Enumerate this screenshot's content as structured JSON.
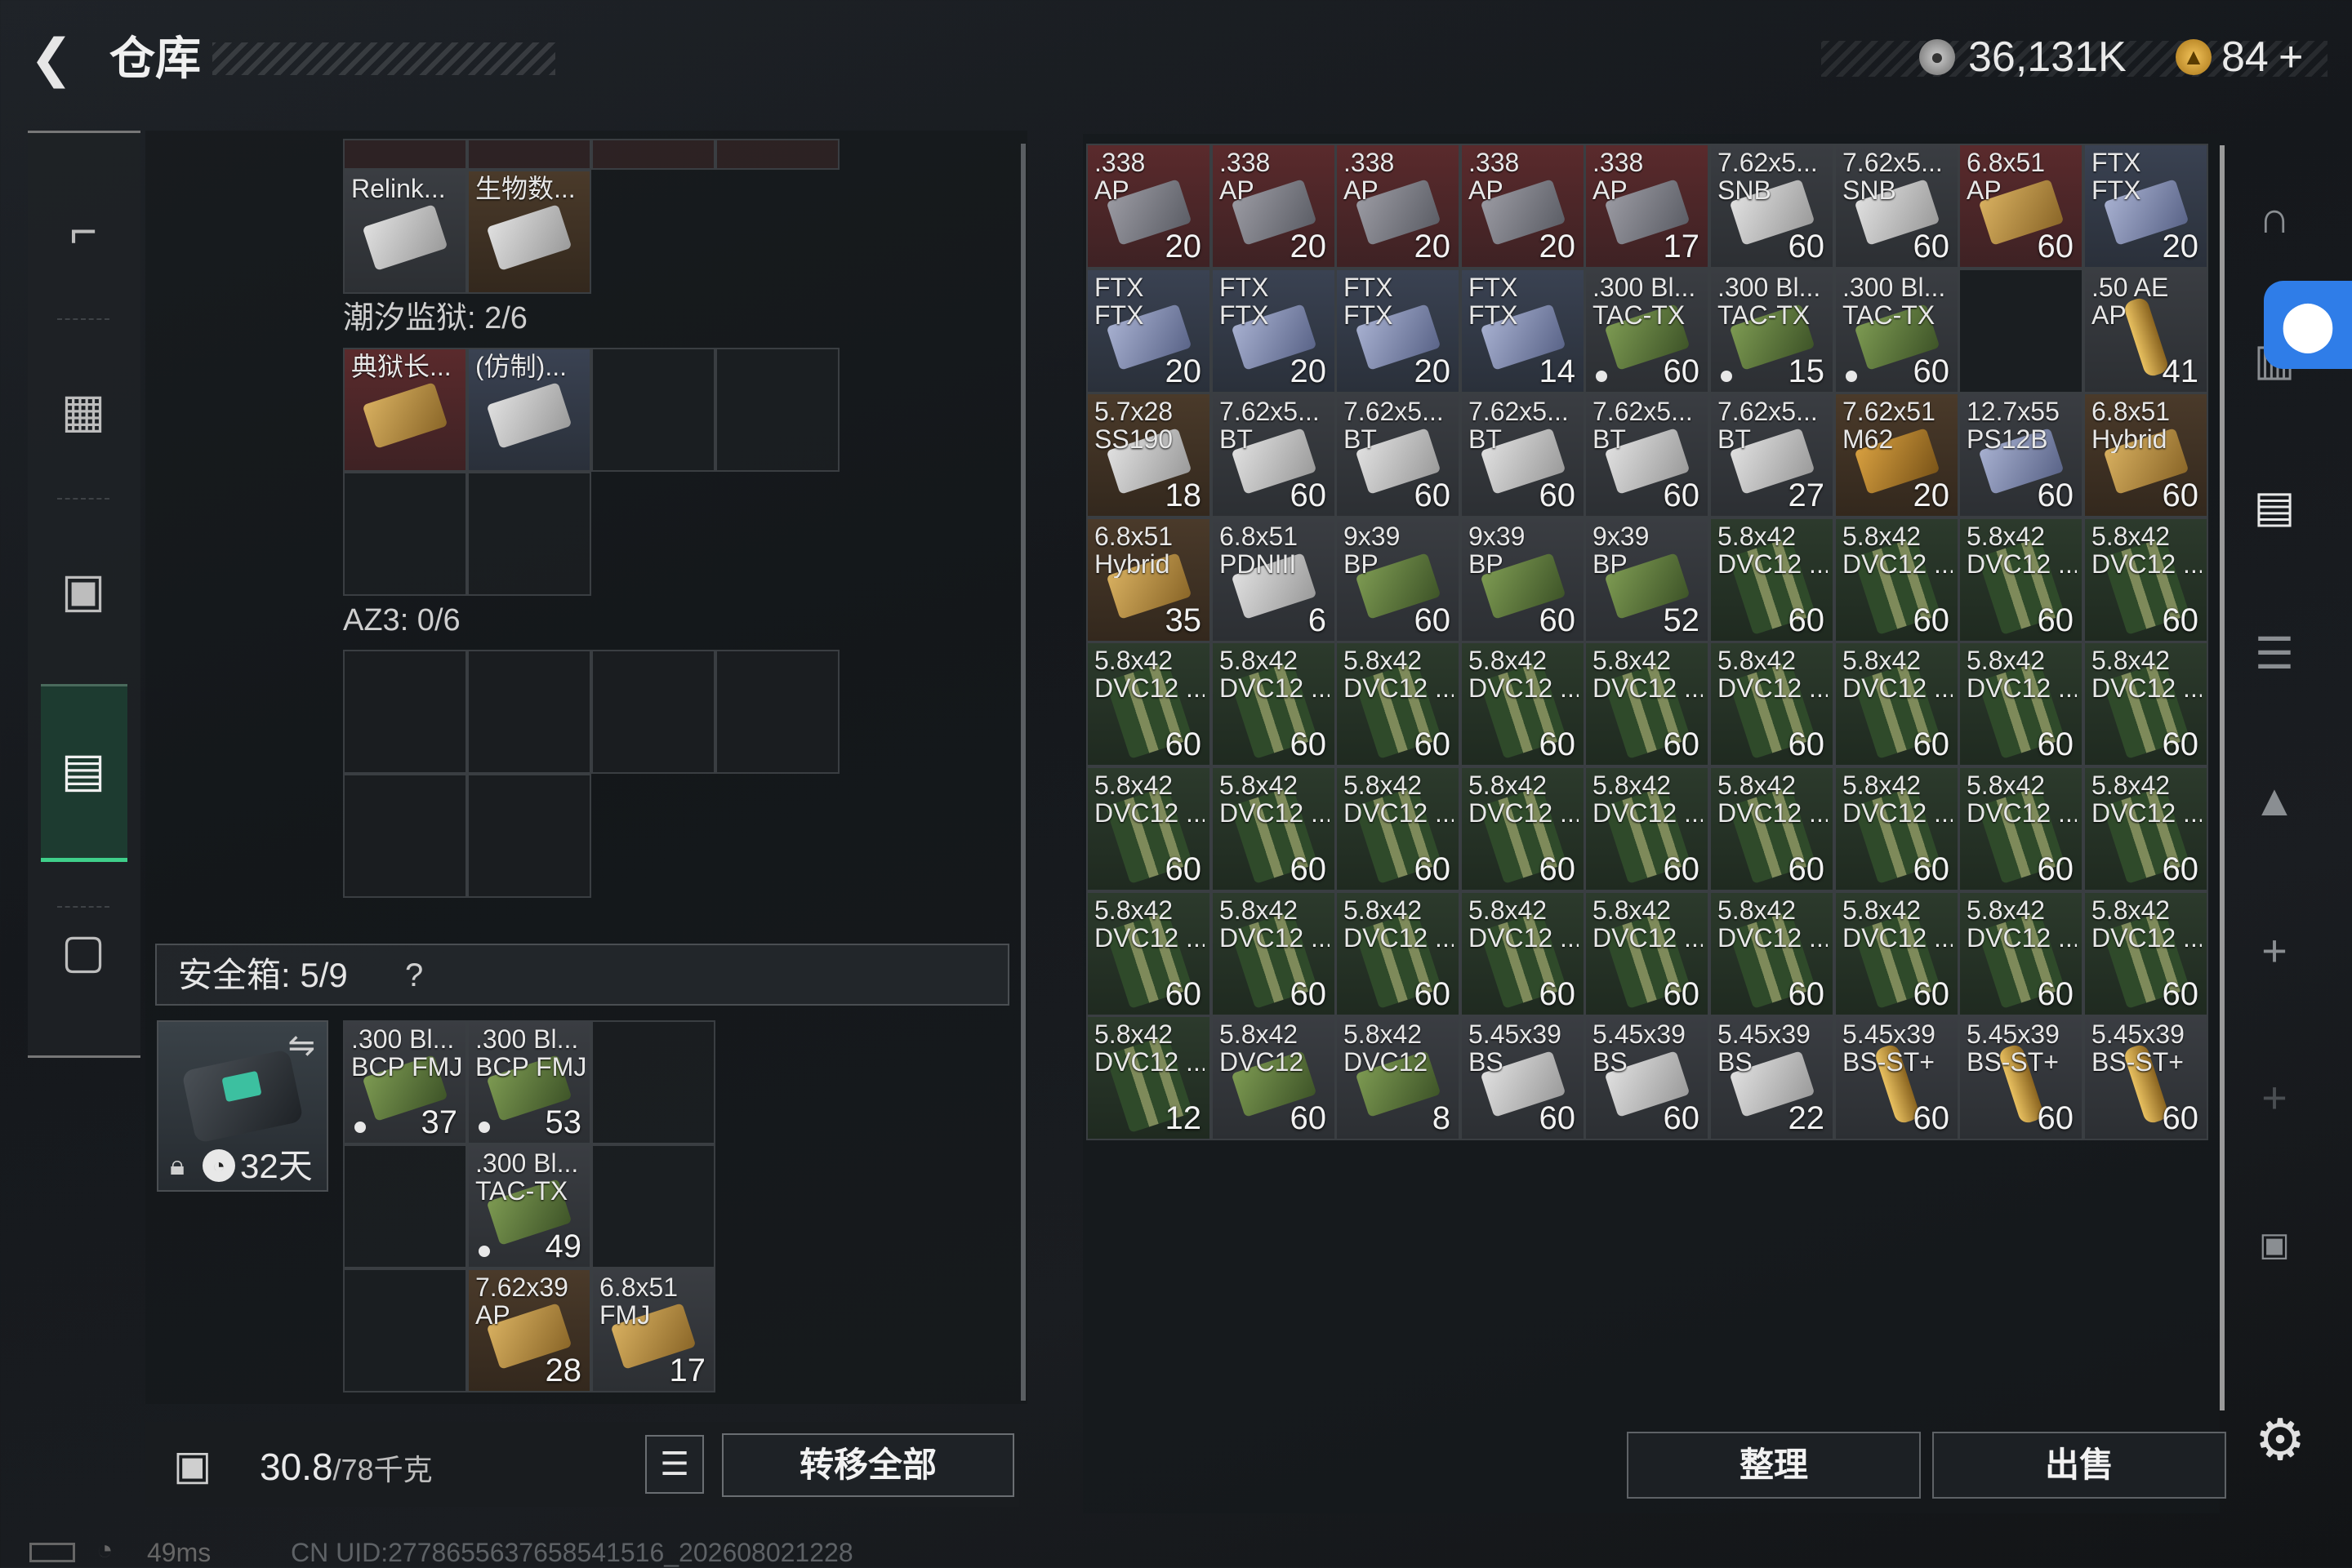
{
  "header": {
    "back_icon": "back-arrow-icon",
    "title": "仓库",
    "money": "36,131K",
    "tickets": "84",
    "plus": "+"
  },
  "nav": {
    "items": [
      "weapon-icon",
      "armor-icon",
      "backpack-icon",
      "storage-icon",
      "case-icon"
    ],
    "active": "storage-icon"
  },
  "left": {
    "top_items": [
      {
        "name": "Relink...",
        "tone": "gray",
        "pic": "white"
      },
      {
        "name": "生物数...",
        "tone": "brown",
        "pic": "white"
      }
    ],
    "tide_label": "潮汐监狱: 2/6",
    "tide_items": [
      {
        "name": "典狱长...",
        "tone": "red",
        "pic": "gold"
      },
      {
        "name": "(仿制)...",
        "tone": "blue",
        "pic": "white"
      }
    ],
    "az3_label": "AZ3: 0/6",
    "safe_label": "安全箱: 5/9",
    "safe_help": "?",
    "case_days": "32天",
    "safe_items": [
      {
        "name": ".300 Bl...\nBCP FMJ",
        "count": "37",
        "tone": "gray",
        "pic": "green",
        "dot": true
      },
      {
        "name": ".300 Bl...\nBCP FMJ",
        "count": "53",
        "tone": "gray",
        "pic": "green",
        "dot": true
      },
      {
        "name": ".300 Bl...\nTAC-TX",
        "count": "49",
        "tone": "gray",
        "pic": "green",
        "dot": true
      },
      {
        "name": "7.62x39\nAP",
        "count": "28",
        "tone": "brown",
        "pic": "gold",
        "dot": false
      },
      {
        "name": "6.8x51\nFMJ",
        "count": "17",
        "tone": "gray",
        "pic": "gold",
        "dot": false
      }
    ]
  },
  "bottom": {
    "weight_value": "30.8",
    "weight_max": "/78千克",
    "transfer_label": "转移全部",
    "sort_label": "整理",
    "sell_label": "出售"
  },
  "status": {
    "ping": "49ms",
    "uid": "CN UID:2778655637658541516_202608021228"
  },
  "grid": [
    {
      "name": ".338\nAP",
      "count": "20",
      "tone": "red",
      "pic": "box"
    },
    {
      "name": ".338\nAP",
      "count": "20",
      "tone": "red",
      "pic": "box"
    },
    {
      "name": ".338\nAP",
      "count": "20",
      "tone": "red",
      "pic": "box"
    },
    {
      "name": ".338\nAP",
      "count": "20",
      "tone": "red",
      "pic": "box"
    },
    {
      "name": ".338\nAP",
      "count": "17",
      "tone": "red",
      "pic": "box"
    },
    {
      "name": "7.62x5...\nSNB",
      "count": "60",
      "tone": "gray",
      "pic": "white"
    },
    {
      "name": "7.62x5...\nSNB",
      "count": "60",
      "tone": "gray",
      "pic": "white"
    },
    {
      "name": "6.8x51\nAP",
      "count": "60",
      "tone": "red",
      "pic": "gold"
    },
    {
      "name": "FTX\nFTX",
      "count": "20",
      "tone": "blue",
      "pic": "blue"
    },
    {
      "name": "FTX\nFTX",
      "count": "20",
      "tone": "blue",
      "pic": "blue"
    },
    {
      "name": "FTX\nFTX",
      "count": "20",
      "tone": "blue",
      "pic": "blue"
    },
    {
      "name": "FTX\nFTX",
      "count": "20",
      "tone": "blue",
      "pic": "blue"
    },
    {
      "name": "FTX\nFTX",
      "count": "14",
      "tone": "blue",
      "pic": "blue"
    },
    {
      "name": ".300 Bl...\nTAC-TX",
      "count": "60",
      "tone": "gray",
      "pic": "green",
      "dot": true
    },
    {
      "name": ".300 Bl...\nTAC-TX",
      "count": "15",
      "tone": "gray",
      "pic": "green",
      "dot": true
    },
    {
      "name": ".300 Bl...\nTAC-TX",
      "count": "60",
      "tone": "gray",
      "pic": "green",
      "dot": true
    },
    {
      "empty": true
    },
    {
      "name": ".50 AE\nAP",
      "count": "41",
      "tone": "gray",
      "pic": "round"
    },
    {
      "name": "5.7x28\nSS190",
      "count": "18",
      "tone": "brown",
      "pic": "white"
    },
    {
      "name": "7.62x5...\nBT",
      "count": "60",
      "tone": "gray",
      "pic": "white"
    },
    {
      "name": "7.62x5...\nBT",
      "count": "60",
      "tone": "gray",
      "pic": "white"
    },
    {
      "name": "7.62x5...\nBT",
      "count": "60",
      "tone": "gray",
      "pic": "white"
    },
    {
      "name": "7.62x5...\nBT",
      "count": "60",
      "tone": "gray",
      "pic": "white"
    },
    {
      "name": "7.62x5...\nBT",
      "count": "27",
      "tone": "gray",
      "pic": "white"
    },
    {
      "name": "7.62x51\nM62",
      "count": "20",
      "tone": "brown",
      "pic": "orange"
    },
    {
      "name": "12.7x55\nPS12B",
      "count": "60",
      "tone": "gray",
      "pic": "blue"
    },
    {
      "name": "6.8x51\nHybrid",
      "count": "60",
      "tone": "brown",
      "pic": "gold"
    },
    {
      "name": "6.8x51\nHybrid",
      "count": "35",
      "tone": "brown",
      "pic": "gold"
    },
    {
      "name": "6.8x51\nPDNIII",
      "count": "6",
      "tone": "gray",
      "pic": "white"
    },
    {
      "name": "9x39\nBP",
      "count": "60",
      "tone": "gray",
      "pic": "green"
    },
    {
      "name": "9x39\nBP",
      "count": "60",
      "tone": "gray",
      "pic": "green"
    },
    {
      "name": "9x39\nBP",
      "count": "52",
      "tone": "gray",
      "pic": "green"
    },
    {
      "name": "5.8x42\nDVC12 ...",
      "count": "60",
      "tone": "green",
      "pic": "shells"
    },
    {
      "name": "5.8x42\nDVC12 ...",
      "count": "60",
      "tone": "green",
      "pic": "shells"
    },
    {
      "name": "5.8x42\nDVC12 ...",
      "count": "60",
      "tone": "green",
      "pic": "shells"
    },
    {
      "name": "5.8x42\nDVC12 ...",
      "count": "60",
      "tone": "green",
      "pic": "shells"
    },
    {
      "name": "5.8x42\nDVC12 ...",
      "count": "60",
      "tone": "green",
      "pic": "shells"
    },
    {
      "name": "5.8x42\nDVC12 ...",
      "count": "60",
      "tone": "green",
      "pic": "shells"
    },
    {
      "name": "5.8x42\nDVC12 ...",
      "count": "60",
      "tone": "green",
      "pic": "shells"
    },
    {
      "name": "5.8x42\nDVC12 ...",
      "count": "60",
      "tone": "green",
      "pic": "shells"
    },
    {
      "name": "5.8x42\nDVC12 ...",
      "count": "60",
      "tone": "green",
      "pic": "shells"
    },
    {
      "name": "5.8x42\nDVC12 ...",
      "count": "60",
      "tone": "green",
      "pic": "shells"
    },
    {
      "name": "5.8x42\nDVC12 ...",
      "count": "60",
      "tone": "green",
      "pic": "shells"
    },
    {
      "name": "5.8x42\nDVC12 ...",
      "count": "60",
      "tone": "green",
      "pic": "shells"
    },
    {
      "name": "5.8x42\nDVC12 ...",
      "count": "60",
      "tone": "green",
      "pic": "shells"
    },
    {
      "name": "5.8x42\nDVC12 ...",
      "count": "60",
      "tone": "green",
      "pic": "shells"
    },
    {
      "name": "5.8x42\nDVC12 ...",
      "count": "60",
      "tone": "green",
      "pic": "shells"
    },
    {
      "name": "5.8x42\nDVC12 ...",
      "count": "60",
      "tone": "green",
      "pic": "shells"
    },
    {
      "name": "5.8x42\nDVC12 ...",
      "count": "60",
      "tone": "green",
      "pic": "shells"
    },
    {
      "name": "5.8x42\nDVC12 ...",
      "count": "60",
      "tone": "green",
      "pic": "shells"
    },
    {
      "name": "5.8x42\nDVC12 ...",
      "count": "60",
      "tone": "green",
      "pic": "shells"
    },
    {
      "name": "5.8x42\nDVC12 ...",
      "count": "60",
      "tone": "green",
      "pic": "shells"
    },
    {
      "name": "5.8x42\nDVC12 ...",
      "count": "60",
      "tone": "green",
      "pic": "shells"
    },
    {
      "name": "5.8x42\nDVC12 ...",
      "count": "60",
      "tone": "green",
      "pic": "shells"
    },
    {
      "name": "5.8x42\nDVC12 ...",
      "count": "60",
      "tone": "green",
      "pic": "shells"
    },
    {
      "name": "5.8x42\nDVC12 ...",
      "count": "60",
      "tone": "green",
      "pic": "shells"
    },
    {
      "name": "5.8x42\nDVC12 ...",
      "count": "60",
      "tone": "green",
      "pic": "shells"
    },
    {
      "name": "5.8x42\nDVC12 ...",
      "count": "60",
      "tone": "green",
      "pic": "shells"
    },
    {
      "name": "5.8x42\nDVC12 ...",
      "count": "60",
      "tone": "green",
      "pic": "shells"
    },
    {
      "name": "5.8x42\nDVC12 ...",
      "count": "60",
      "tone": "green",
      "pic": "shells"
    },
    {
      "name": "5.8x42\nDVC12 ...",
      "count": "60",
      "tone": "green",
      "pic": "shells"
    },
    {
      "name": "5.8x42\nDVC12 ...",
      "count": "60",
      "tone": "green",
      "pic": "shells"
    },
    {
      "name": "5.8x42\nDVC12 ...",
      "count": "60",
      "tone": "green",
      "pic": "shells"
    },
    {
      "name": "5.8x42\nDVC12 ...",
      "count": "12",
      "tone": "green",
      "pic": "shells"
    },
    {
      "name": "5.8x42\nDVC12",
      "count": "60",
      "tone": "gray",
      "pic": "green"
    },
    {
      "name": "5.8x42\nDVC12",
      "count": "8",
      "tone": "gray",
      "pic": "green"
    },
    {
      "name": "5.45x39\nBS",
      "count": "60",
      "tone": "gray",
      "pic": "white"
    },
    {
      "name": "5.45x39\nBS",
      "count": "60",
      "tone": "gray",
      "pic": "white"
    },
    {
      "name": "5.45x39\nBS",
      "count": "22",
      "tone": "gray",
      "pic": "white"
    },
    {
      "name": "5.45x39\nBS-ST+",
      "count": "60",
      "tone": "gray",
      "pic": "round"
    },
    {
      "name": "5.45x39\nBS-ST+",
      "count": "60",
      "tone": "gray",
      "pic": "round"
    },
    {
      "name": "5.45x39\nBS-ST+",
      "count": "60",
      "tone": "gray",
      "pic": "round"
    }
  ],
  "side_icons": [
    "helmet-icon",
    "vest-icon",
    "rig-icon",
    "rack-icon",
    "frame-icon",
    "plus-icon",
    "plus-icon-2",
    "lock-icon"
  ],
  "accessibility_icon": "accessibility-icon",
  "settings_icon": "gear-icon"
}
